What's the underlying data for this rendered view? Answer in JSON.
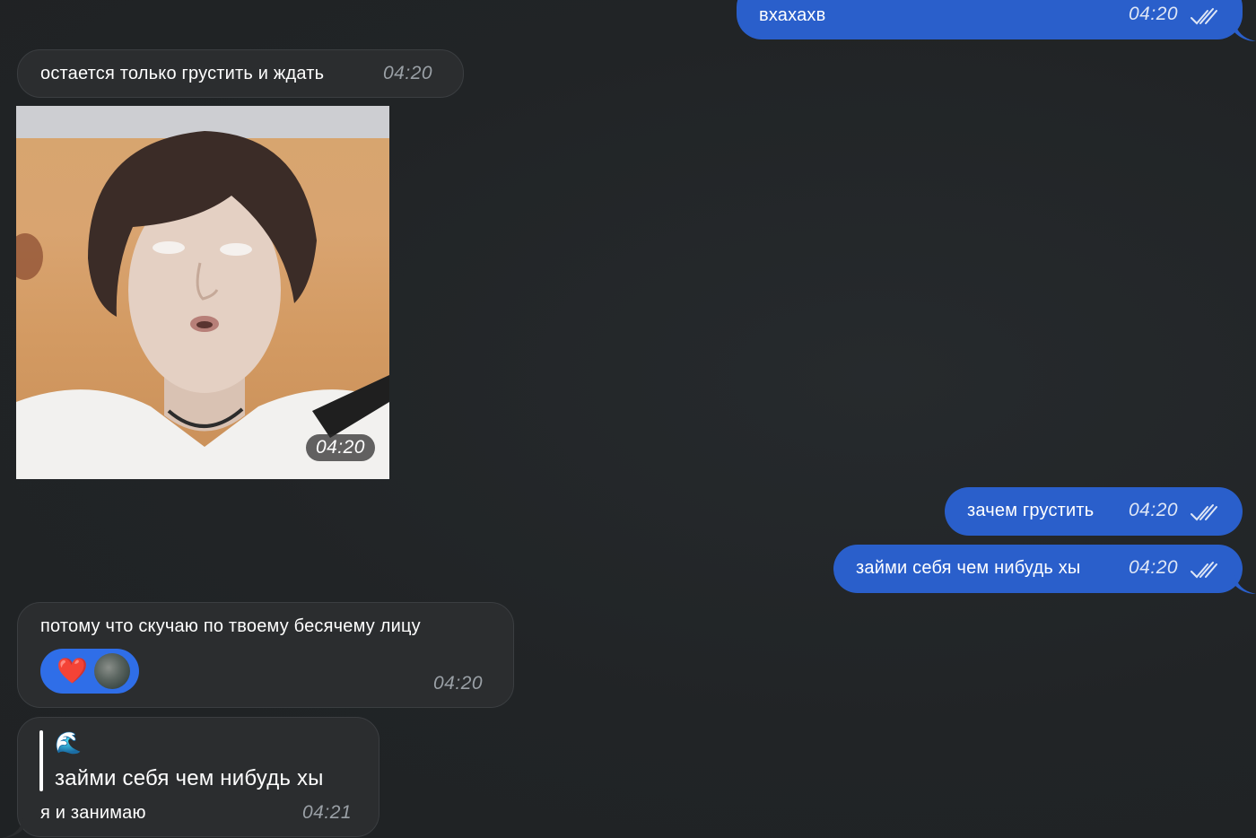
{
  "messages": {
    "m1": {
      "text": "вхахахв",
      "time": "04:20",
      "direction": "outgoing",
      "status": "read"
    },
    "m2": {
      "text": "остается только грустить и ждать",
      "time": "04:20",
      "direction": "incoming"
    },
    "m3": {
      "type": "photo",
      "time": "04:20",
      "direction": "incoming"
    },
    "m4": {
      "text": "зачем грустить",
      "time": "04:20",
      "direction": "outgoing",
      "status": "read"
    },
    "m5": {
      "text": "займи себя чем нибудь хы",
      "time": "04:20",
      "direction": "outgoing",
      "status": "read"
    },
    "m6": {
      "text": "потому что скучаю по твоему бесячему лицу",
      "time": "04:20",
      "direction": "incoming",
      "reaction": {
        "emoji": "❤️",
        "icon": "heart-icon"
      }
    },
    "m7": {
      "reply_sender": "🌊",
      "reply_text": "займи себя чем нибудь хы",
      "text": "я и занимаю",
      "time": "04:21",
      "direction": "incoming"
    }
  },
  "colors": {
    "background": "#212426",
    "incoming_bubble": "#2b2d2f",
    "outgoing_bubble": "#2a5fcb",
    "reaction": "#2f6ee8"
  }
}
